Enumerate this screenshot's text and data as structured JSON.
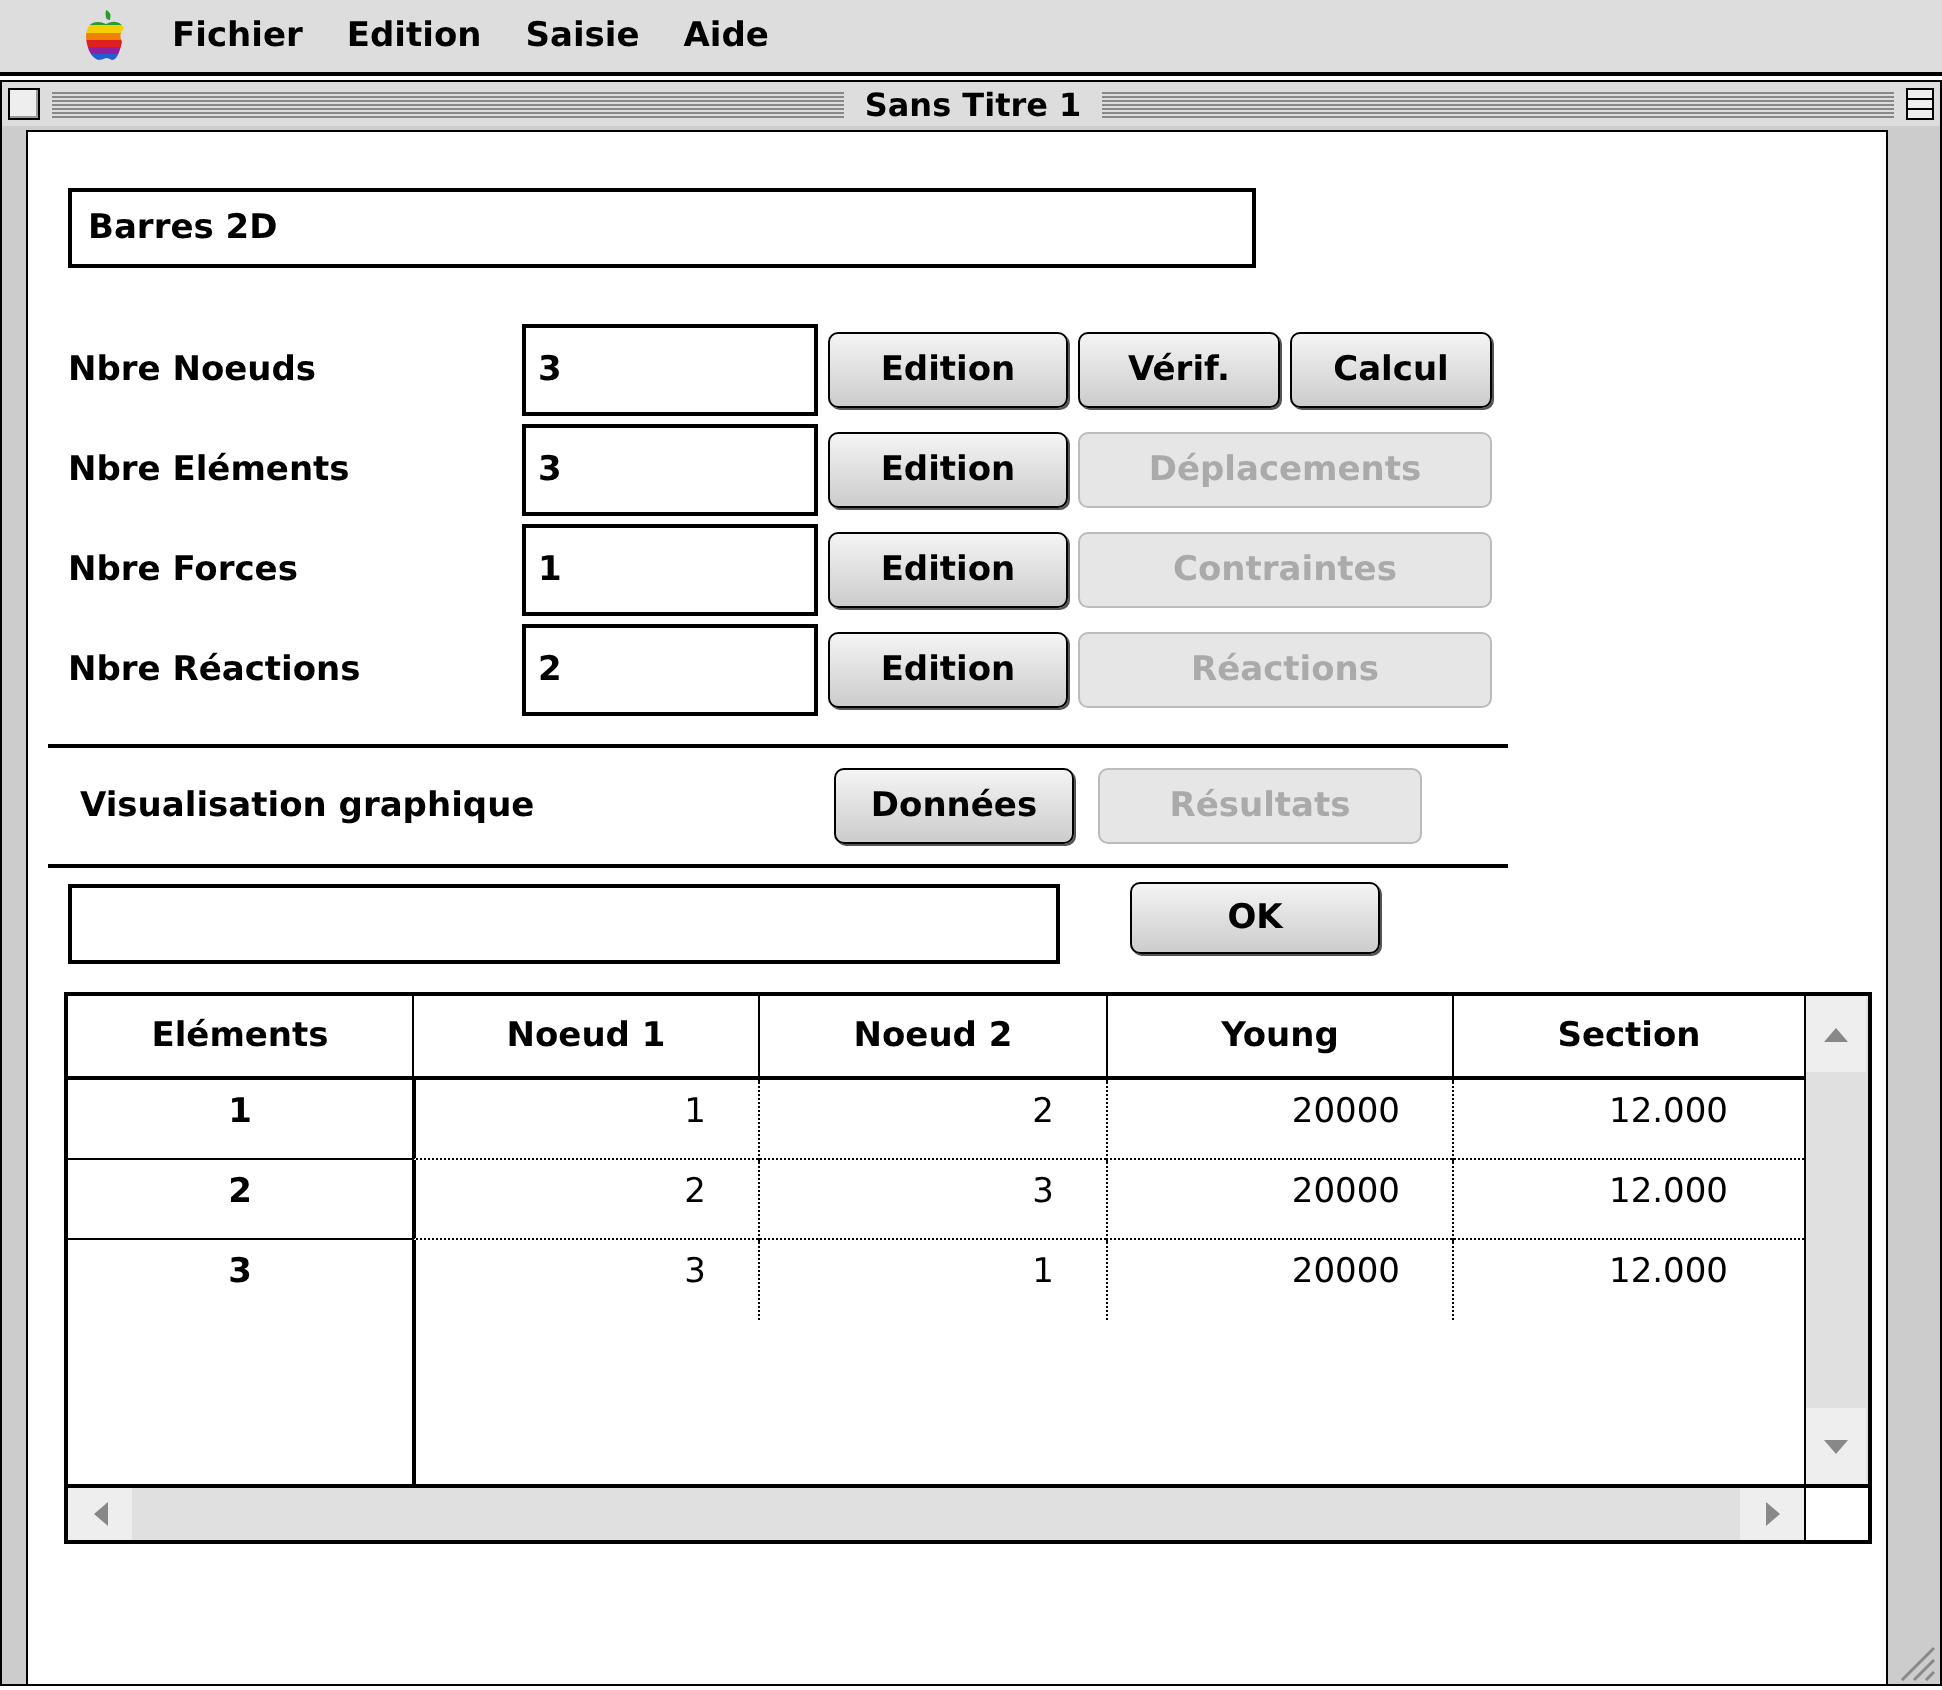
{
  "menu_bar": {
    "items": [
      "Fichier",
      "Edition",
      "Saisie",
      "Aide"
    ]
  },
  "window": {
    "title": "Sans Titre 1"
  },
  "name_field": {
    "value": "Barres 2D"
  },
  "counts": [
    {
      "label": "Nbre Noeuds",
      "value": "3",
      "buttons": [
        {
          "label": "Edition",
          "disabled": false
        },
        {
          "label": "Vérif.",
          "disabled": false
        },
        {
          "label": "Calcul",
          "disabled": false
        }
      ]
    },
    {
      "label": "Nbre Eléments",
      "value": "3",
      "buttons": [
        {
          "label": "Edition",
          "disabled": false
        },
        {
          "label": "Déplacements",
          "disabled": true
        }
      ]
    },
    {
      "label": "Nbre Forces",
      "value": "1",
      "buttons": [
        {
          "label": "Edition",
          "disabled": false
        },
        {
          "label": "Contraintes",
          "disabled": true
        }
      ]
    },
    {
      "label": "Nbre Réactions",
      "value": "2",
      "buttons": [
        {
          "label": "Edition",
          "disabled": false
        },
        {
          "label": "Réactions",
          "disabled": true
        }
      ]
    }
  ],
  "visualisation": {
    "label": "Visualisation graphique",
    "buttons": [
      {
        "label": "Données",
        "disabled": false
      },
      {
        "label": "Résultats",
        "disabled": true
      }
    ]
  },
  "ok_button": {
    "label": "OK"
  },
  "table": {
    "columns": [
      "Eléments",
      "Noeud 1",
      "Noeud 2",
      "Young",
      "Section"
    ],
    "rows": [
      [
        "1",
        "1",
        "2",
        "20000",
        "12.000"
      ],
      [
        "2",
        "2",
        "3",
        "20000",
        "12.000"
      ],
      [
        "3",
        "3",
        "1",
        "20000",
        "12.000"
      ]
    ]
  }
}
